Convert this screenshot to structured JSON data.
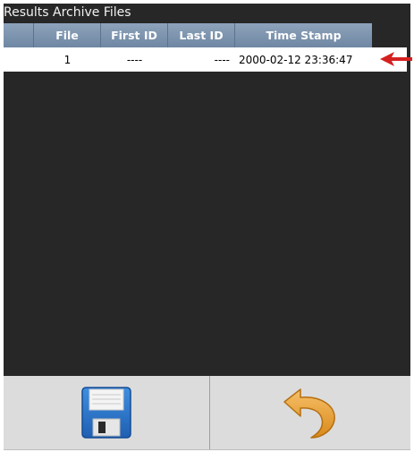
{
  "window": {
    "title": "Results Archive Files"
  },
  "table": {
    "columns": [
      "",
      "File",
      "First ID",
      "Last ID",
      "Time Stamp"
    ],
    "rows": [
      {
        "marker": "",
        "file": "1",
        "first_id": "----",
        "last_id": "----",
        "time_stamp": "2000-02-12 23:36:47"
      }
    ]
  },
  "icons": {
    "row_pointer": "arrow-left-icon",
    "save": "floppy-disk-icon",
    "undo": "undo-arrow-icon"
  },
  "colors": {
    "header": "#7a91ac",
    "pointer": "#d42020",
    "panel": "#272727",
    "toolbar": "#dcdcdc"
  }
}
